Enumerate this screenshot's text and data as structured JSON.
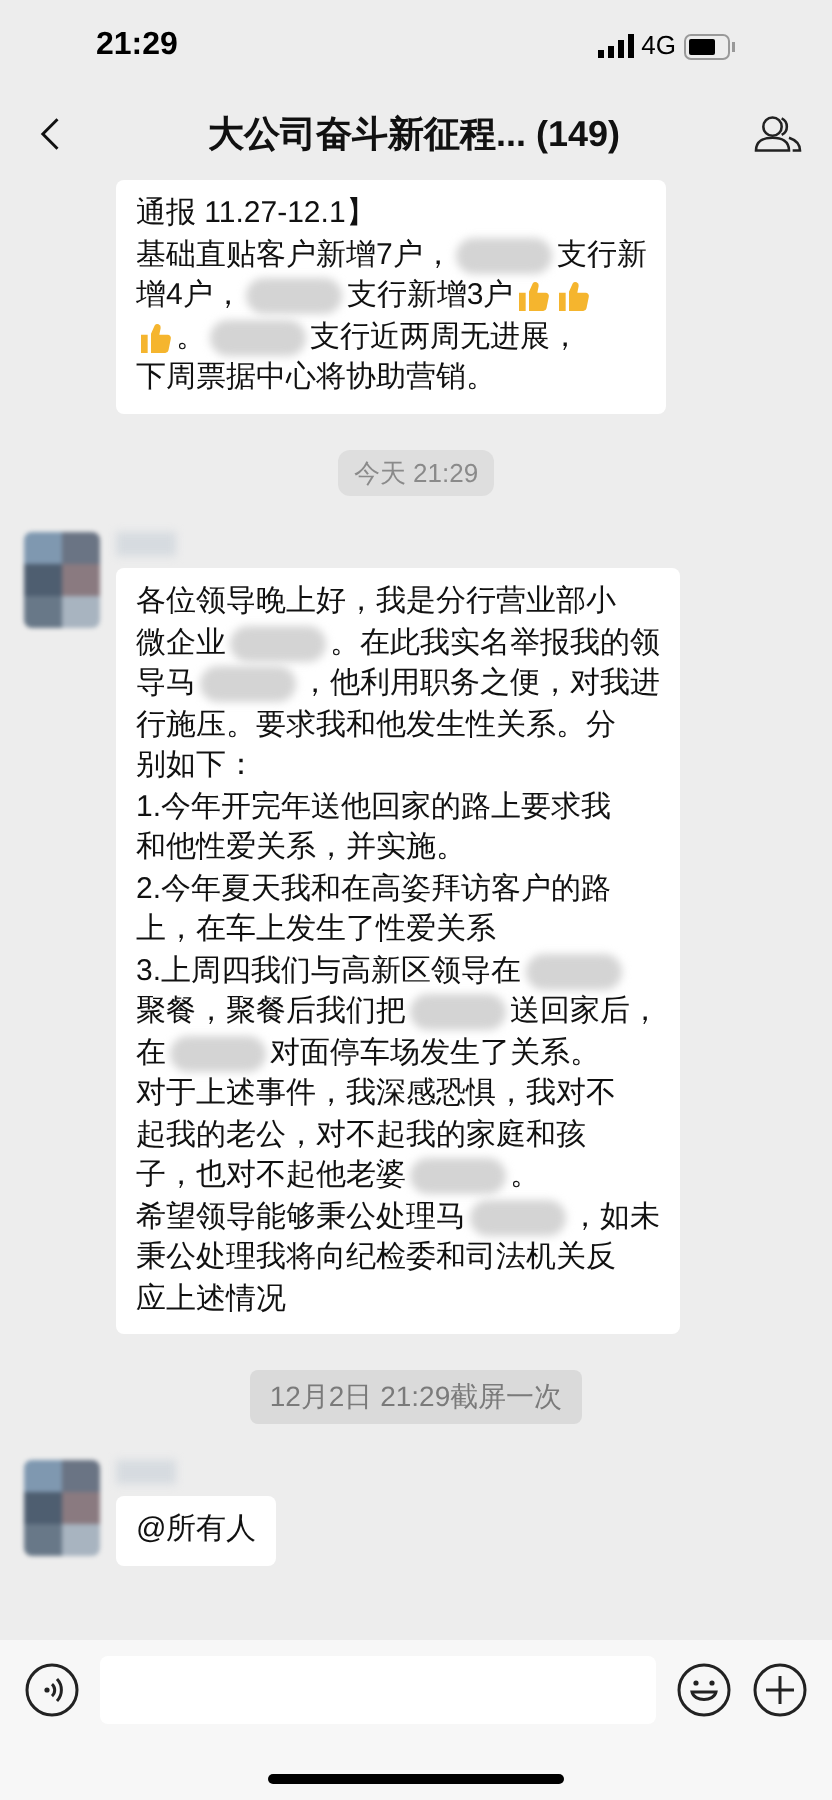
{
  "status_bar": {
    "time": "21:29",
    "network": "4G"
  },
  "header": {
    "title": "大公司奋斗新征程... (149)"
  },
  "messages": [
    {
      "kind": "bubble",
      "avatar": false,
      "lines": [
        [
          {
            "kind": "text",
            "text": "通报 11.27-12.1】"
          }
        ],
        [
          {
            "kind": "text",
            "text": "基础直贴客户新增7户，"
          },
          {
            "kind": "blur"
          },
          {
            "kind": "text",
            "text": "支行新"
          }
        ],
        [
          {
            "kind": "text",
            "text": "增4户，"
          },
          {
            "kind": "blur"
          },
          {
            "kind": "text",
            "text": "支行新增3户"
          },
          {
            "kind": "thumb"
          },
          {
            "kind": "thumb"
          }
        ],
        [
          {
            "kind": "thumb"
          },
          {
            "kind": "text",
            "text": "。"
          },
          {
            "kind": "blur"
          },
          {
            "kind": "text",
            "text": "支行近两周无进展，"
          }
        ],
        [
          {
            "kind": "text",
            "text": "下周票据中心将协助营销。"
          }
        ]
      ]
    },
    {
      "kind": "time",
      "text": "今天 21:29"
    },
    {
      "kind": "bubble",
      "avatar": true,
      "lines": [
        [
          {
            "kind": "text",
            "text": "各位领导晚上好，我是分行营业部小"
          }
        ],
        [
          {
            "kind": "text",
            "text": "微企业"
          },
          {
            "kind": "blur"
          },
          {
            "kind": "text",
            "text": "。在此我实名举报我的领"
          }
        ],
        [
          {
            "kind": "text",
            "text": "导马"
          },
          {
            "kind": "blur"
          },
          {
            "kind": "text",
            "text": "，他利用职务之便，对我进"
          }
        ],
        [
          {
            "kind": "text",
            "text": "行施压。要求我和他发生性关系。分"
          }
        ],
        [
          {
            "kind": "text",
            "text": "别如下："
          }
        ],
        [
          {
            "kind": "text",
            "text": "1.今年开完年送他回家的路上要求我"
          }
        ],
        [
          {
            "kind": "text",
            "text": "和他性爱关系，并实施。"
          }
        ],
        [
          {
            "kind": "text",
            "text": "2.今年夏天我和在高姿拜访客户的路"
          }
        ],
        [
          {
            "kind": "text",
            "text": "上，在车上发生了性爱关系"
          }
        ],
        [
          {
            "kind": "text",
            "text": "3.上周四我们与高新区领导在"
          },
          {
            "kind": "blur"
          }
        ],
        [
          {
            "kind": "text",
            "text": "聚餐，聚餐后我们把"
          },
          {
            "kind": "blur"
          },
          {
            "kind": "text",
            "text": "送回家后，"
          }
        ],
        [
          {
            "kind": "text",
            "text": "在"
          },
          {
            "kind": "blur"
          },
          {
            "kind": "text",
            "text": "对面停车场发生了关系。"
          }
        ],
        [
          {
            "kind": "text",
            "text": "对于上述事件，我深感恐惧，我对不"
          }
        ],
        [
          {
            "kind": "text",
            "text": "起我的老公，对不起我的家庭和孩"
          }
        ],
        [
          {
            "kind": "text",
            "text": "子，也对不起他老婆"
          },
          {
            "kind": "blur"
          },
          {
            "kind": "text",
            "text": "。"
          }
        ],
        [
          {
            "kind": "text",
            "text": "希望领导能够秉公处理马"
          },
          {
            "kind": "blur"
          },
          {
            "kind": "text",
            "text": "，如未"
          }
        ],
        [
          {
            "kind": "text",
            "text": "秉公处理我将向纪检委和司法机关反"
          }
        ],
        [
          {
            "kind": "text",
            "text": "应上述情况"
          }
        ]
      ]
    },
    {
      "kind": "notice",
      "text": "12月2日 21:29截屏一次"
    },
    {
      "kind": "bubble",
      "avatar": true,
      "lines": [
        [
          {
            "kind": "text",
            "text": "@所有人"
          }
        ]
      ]
    }
  ]
}
